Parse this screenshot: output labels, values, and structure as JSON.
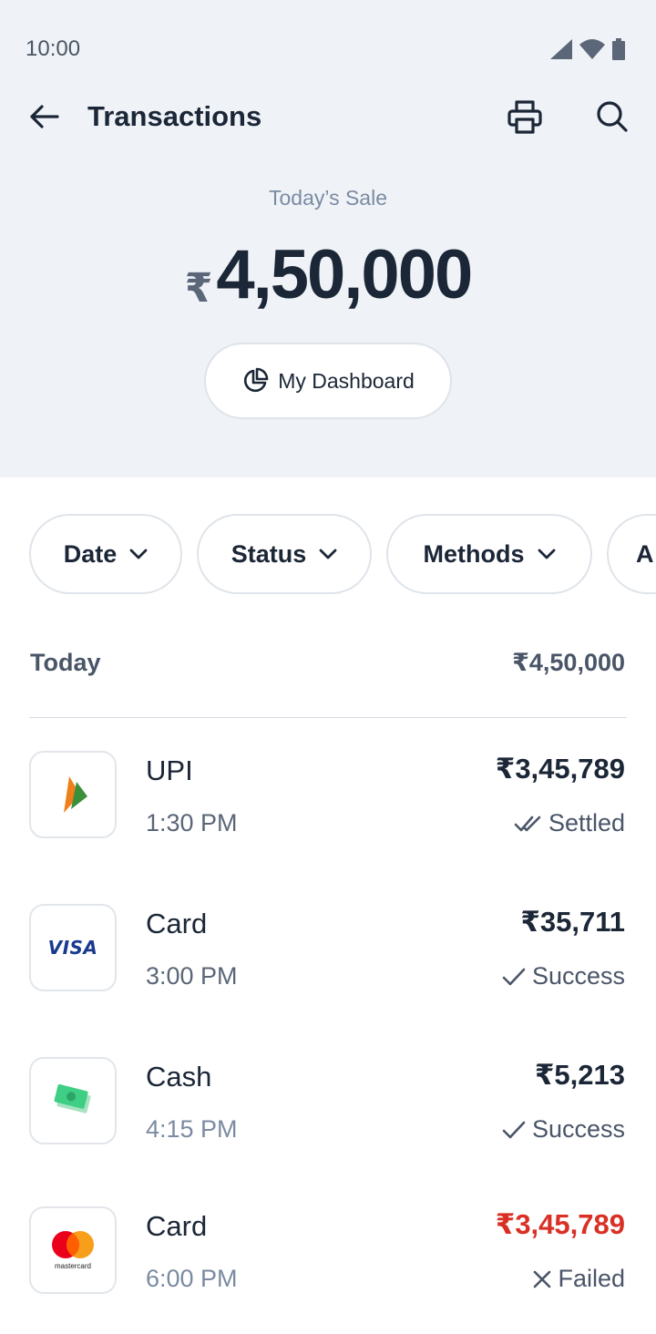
{
  "status_bar": {
    "time": "10:00"
  },
  "header": {
    "title": "Transactions"
  },
  "summary": {
    "label": "Today’s Sale",
    "currency": "₹",
    "amount": "4,50,000"
  },
  "dashboard_button": {
    "label": "My Dashboard"
  },
  "filters": [
    {
      "label": "Date"
    },
    {
      "label": "Status"
    },
    {
      "label": "Methods"
    },
    {
      "label": "A"
    }
  ],
  "group": {
    "label": "Today",
    "total": "₹4,50,000"
  },
  "transactions": [
    {
      "method": "UPI",
      "time": "1:30 PM",
      "amount": "₹3,45,789",
      "status": "Settled",
      "status_icon": "double-check-icon",
      "logo": "upi-logo"
    },
    {
      "method": "Card",
      "time": "3:00 PM",
      "amount": "₹35,711",
      "status": "Success",
      "status_icon": "check-icon",
      "logo": "visa-logo",
      "logo_text": "VISA"
    },
    {
      "method": "Cash",
      "time": "4:15 PM",
      "amount": "₹5,213",
      "status": "Success",
      "status_icon": "check-icon",
      "logo": "cash-logo"
    },
    {
      "method": "Card",
      "time": "6:00 PM",
      "amount": "₹3,45,789",
      "status": "Failed",
      "status_icon": "cross-icon",
      "logo": "mastercard-logo",
      "logo_text": "mastercard"
    }
  ],
  "colors": {
    "header_bg": "#eff3f8",
    "text_primary": "#1b2636",
    "text_muted": "#7b8ba1",
    "failed": "#d93025"
  }
}
